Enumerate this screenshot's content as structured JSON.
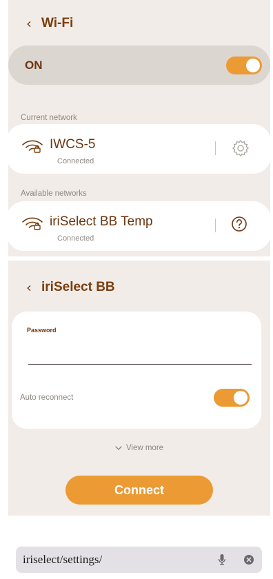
{
  "wifi_screen": {
    "back_glyph": "‹",
    "title": "Wi-Fi",
    "toggle_label": "ON",
    "toggle_state": true,
    "current_network_label": "Current network",
    "current_network": {
      "ssid": "IWCS-5",
      "status": "Connected",
      "action_icon": "gear-icon"
    },
    "available_networks_label": "Available networks",
    "available_networks": [
      {
        "ssid": "iriSelect BB Temp",
        "status": "Connected",
        "action_icon": "help-circle-icon"
      }
    ]
  },
  "network_detail": {
    "back_glyph": "‹",
    "title": "iriSelect BB",
    "password_label": "Password",
    "password_value": "",
    "auto_reconnect_label": "Auto reconnect",
    "auto_reconnect_state": true,
    "view_more_label": "View more",
    "connect_label": "Connect"
  },
  "browser": {
    "url": "iriselect/settings/",
    "icons": [
      "microphone-icon",
      "clear-icon"
    ]
  },
  "colors": {
    "accent": "#ec9a33",
    "brand_text": "#7a3d0e",
    "panel_bg": "#f1ece8",
    "muted_text": "#8d8883"
  }
}
